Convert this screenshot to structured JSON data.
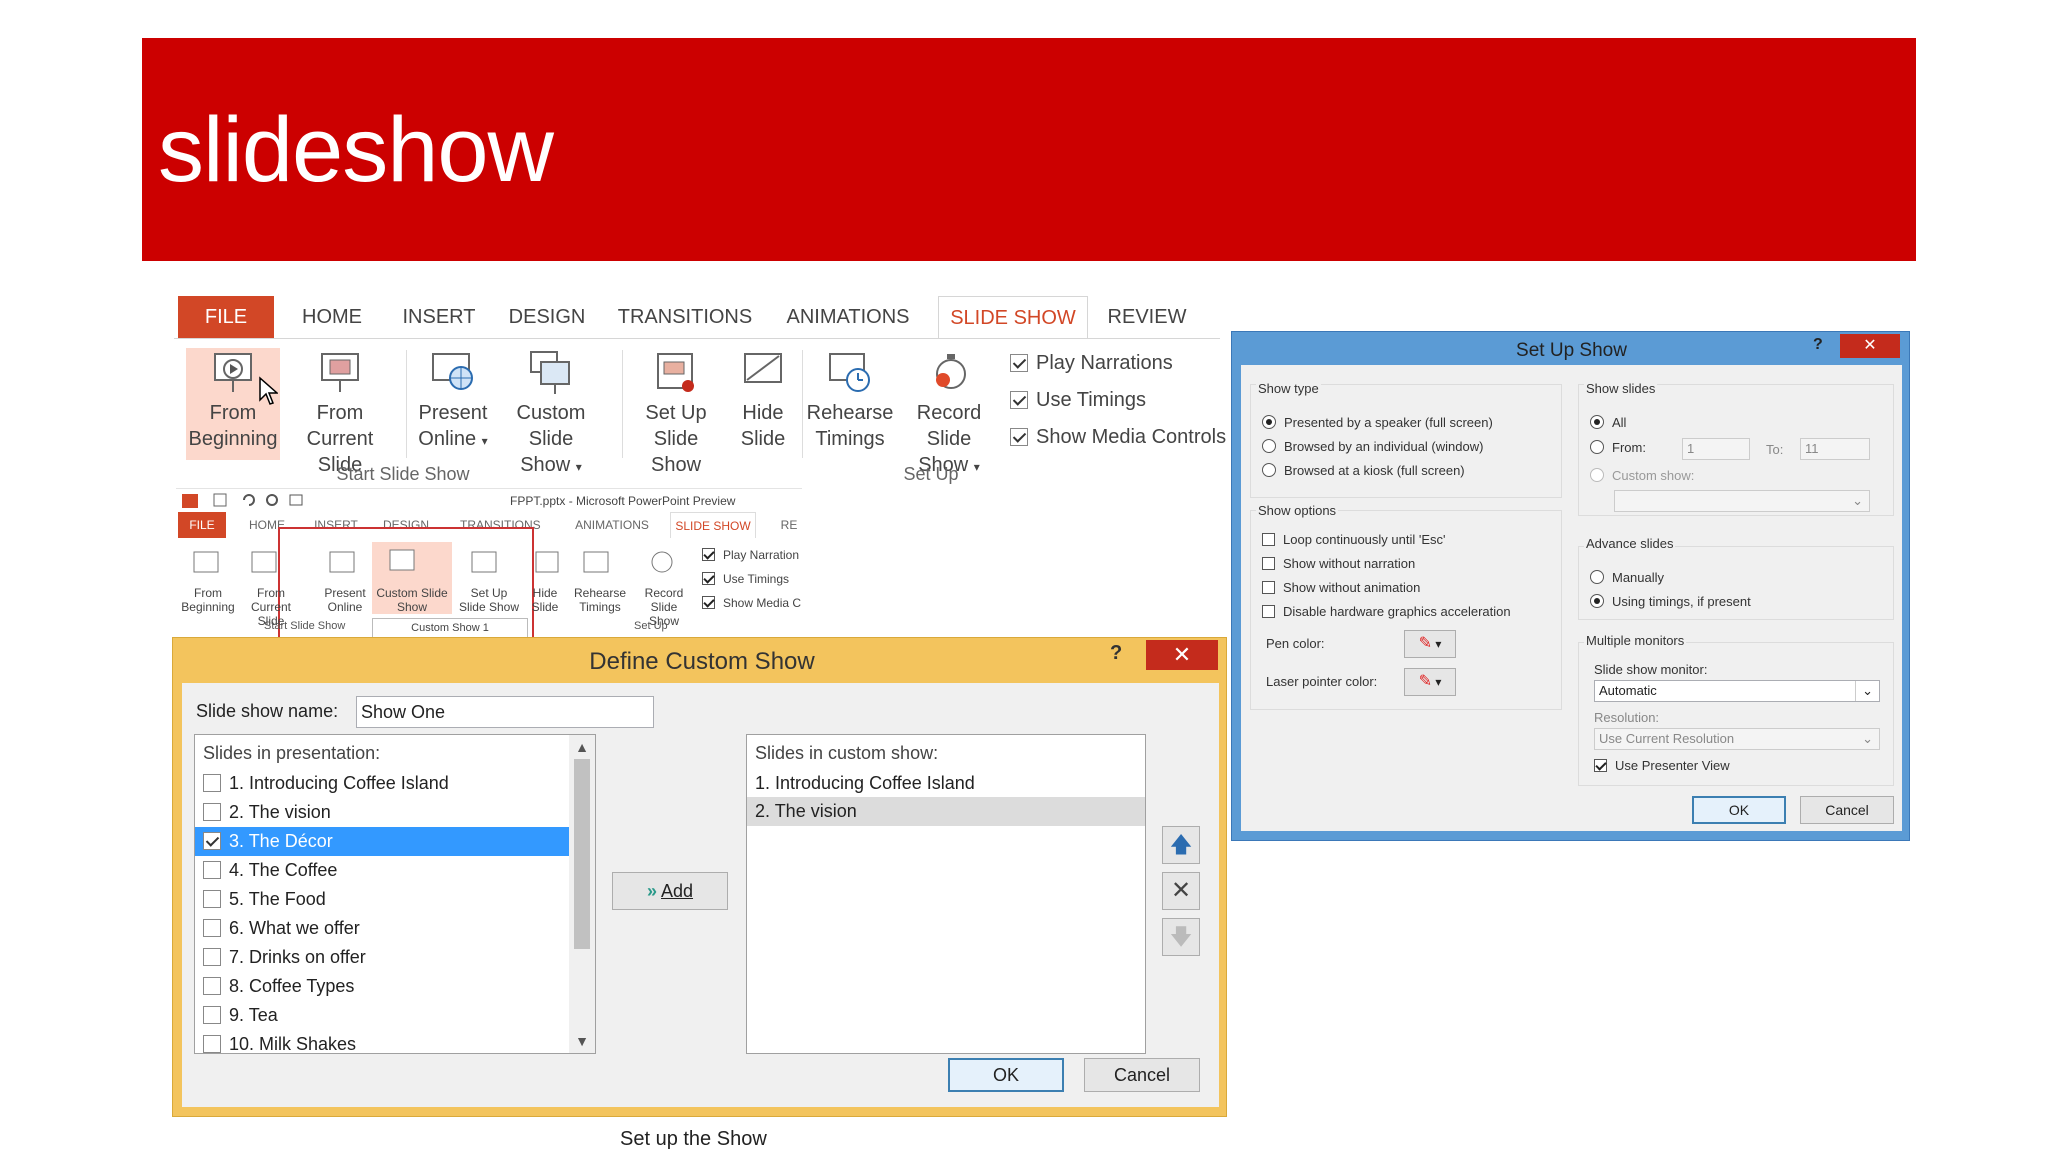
{
  "slide": {
    "title": "slideshow",
    "caption": "Set up the Show"
  },
  "ribbon": {
    "tabs": [
      "FILE",
      "HOME",
      "INSERT",
      "DESIGN",
      "TRANSITIONS",
      "ANIMATIONS",
      "SLIDE SHOW",
      "REVIEW"
    ],
    "buttons": {
      "from_beginning": [
        "From",
        "Beginning"
      ],
      "from_current": [
        "From",
        "Current Slide"
      ],
      "present_online": [
        "Present",
        "Online"
      ],
      "custom_slide_show": [
        "Custom Slide",
        "Show"
      ],
      "set_up": [
        "Set Up",
        "Slide Show"
      ],
      "hide_slide": [
        "Hide",
        "Slide"
      ],
      "rehearse": [
        "Rehearse",
        "Timings"
      ],
      "record": [
        "Record Slide",
        "Show"
      ]
    },
    "checks": [
      "Play Narrations",
      "Use Timings",
      "Show Media Controls"
    ],
    "groups": {
      "start": "Start Slide Show",
      "setup": "Set Up"
    }
  },
  "mini": {
    "title": "FPPT.pptx - Microsoft PowerPoint Preview",
    "tabs": [
      "FILE",
      "HOME",
      "INSERT",
      "DESIGN",
      "TRANSITIONS",
      "ANIMATIONS",
      "SLIDE SHOW",
      "RE"
    ],
    "buttons": [
      [
        "From",
        "Beginning"
      ],
      [
        "From",
        "Current Slide"
      ],
      [
        "Present",
        "Online"
      ],
      [
        "Custom Slide",
        "Show"
      ],
      [
        "Set Up",
        "Slide Show"
      ],
      [
        "Hide",
        "Slide"
      ],
      [
        "Rehearse",
        "Timings"
      ],
      [
        "Record Slide",
        "Show"
      ]
    ],
    "checks": [
      "Play Narration",
      "Use Timings",
      "Show Media C"
    ],
    "group_start": "Start Slide Show",
    "custom_show_item": "Custom Show 1",
    "group_setup": "Set Up"
  },
  "define": {
    "title": "Define Custom Show",
    "help": "?",
    "close": "✕",
    "name_label": "Slide show name:",
    "name_value": "Show One",
    "left_header": "Slides in presentation:",
    "slides": [
      "1. Introducing Coffee Island",
      "2. The vision",
      "3. The Décor",
      "4. The Coffee",
      "5. The Food",
      "6. What we offer",
      "7. Drinks on offer",
      "8. Coffee Types",
      "9. Tea",
      "10. Milk Shakes"
    ],
    "selected_index": 2,
    "add": "Add",
    "right_header": "Slides in custom show:",
    "custom": [
      "1. Introducing Coffee Island",
      "2. The vision"
    ],
    "ok": "OK",
    "cancel": "Cancel"
  },
  "setup": {
    "title": "Set Up Show",
    "help": "?",
    "close": "✕",
    "show_type": "Show type",
    "types": [
      "Presented by a speaker (full screen)",
      "Browsed by an individual (window)",
      "Browsed at a kiosk (full screen)"
    ],
    "show_options": "Show options",
    "options": [
      "Loop continuously until 'Esc'",
      "Show without narration",
      "Show without animation",
      "Disable hardware graphics acceleration"
    ],
    "pen_color": "Pen color:",
    "laser_color": "Laser pointer color:",
    "show_slides": "Show slides",
    "all": "All",
    "from": "From:",
    "from_val": "1",
    "to": "To:",
    "to_val": "11",
    "custom_show": "Custom show:",
    "advance": "Advance slides",
    "manually": "Manually",
    "using_timings": "Using timings, if present",
    "multi": "Multiple monitors",
    "monitor_label": "Slide show monitor:",
    "monitor_val": "Automatic",
    "res_label": "Resolution:",
    "res_val": "Use Current Resolution",
    "presenter": "Use Presenter View",
    "ok": "OK",
    "cancel": "Cancel"
  },
  "colors": {
    "banner": "#cc0000",
    "accent": "#d24726",
    "dialog_frame": "#f3c45d",
    "setup_frame": "#5b9bd5",
    "selection": "#3399ff"
  }
}
